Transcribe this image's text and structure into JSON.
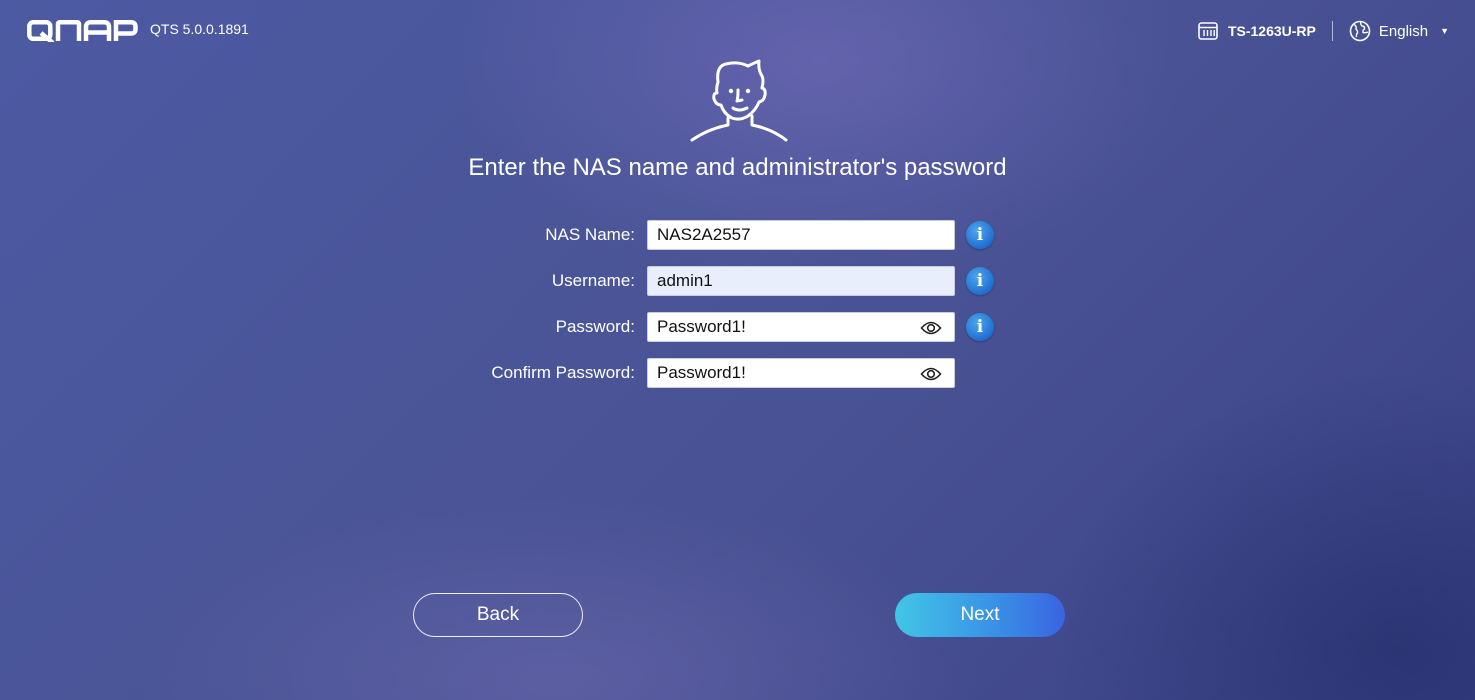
{
  "header": {
    "brand": "QNAP",
    "version": "QTS 5.0.0.1891",
    "model": "TS-1263U-RP",
    "language": "English",
    "icons": [
      "nas-device-icon",
      "globe-icon",
      "caret-down-icon"
    ]
  },
  "main": {
    "title": "Enter the NAS name and administrator's password",
    "avatar_icon": "user-avatar-icon",
    "fields": [
      {
        "label": "NAS Name:",
        "value": "NAS2A2557",
        "has_info": true,
        "has_eye": false
      },
      {
        "label": "Username:",
        "value": "admin1",
        "has_info": true,
        "has_eye": false
      },
      {
        "label": "Password:",
        "value": "Password1!",
        "has_info": true,
        "has_eye": true
      },
      {
        "label": "Confirm Password:",
        "value": "Password1!",
        "has_info": false,
        "has_eye": true
      }
    ],
    "info_glyph": "i"
  },
  "buttons": {
    "back": "Back",
    "next": "Next"
  },
  "colors": {
    "info": "#2b7fdc",
    "next_start": "#41c6e6",
    "next_end": "#3a64e0"
  }
}
